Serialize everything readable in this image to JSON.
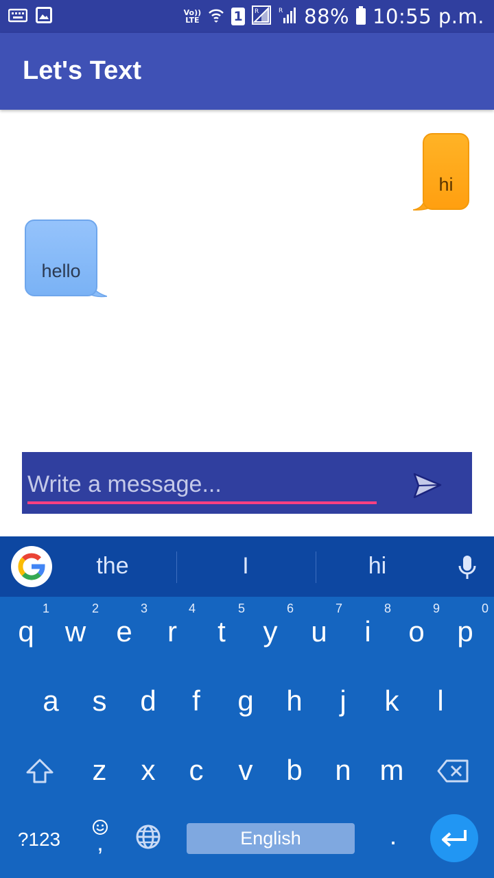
{
  "status_bar": {
    "volte_top": "Vo))",
    "volte_bottom": "LTE",
    "sim_slot": "1",
    "battery": "88%",
    "time": "10:55 p.m."
  },
  "app_bar": {
    "title": "Let's Text"
  },
  "messages": [
    {
      "text": "hi",
      "direction": "outgoing",
      "color": "#ffa51c"
    },
    {
      "text": "hello",
      "direction": "incoming",
      "color": "#8abcf8"
    }
  ],
  "compose": {
    "placeholder": "Write a message...",
    "value": "",
    "accent": "#ff4081",
    "background": "#303f9f"
  },
  "keyboard": {
    "suggestions": [
      "the",
      "I",
      "hi"
    ],
    "row1": [
      {
        "key": "q",
        "hint": "1"
      },
      {
        "key": "w",
        "hint": "2"
      },
      {
        "key": "e",
        "hint": "3"
      },
      {
        "key": "r",
        "hint": "4"
      },
      {
        "key": "t",
        "hint": "5"
      },
      {
        "key": "y",
        "hint": "6"
      },
      {
        "key": "u",
        "hint": "7"
      },
      {
        "key": "i",
        "hint": "8"
      },
      {
        "key": "o",
        "hint": "9"
      },
      {
        "key": "p",
        "hint": "0"
      }
    ],
    "row2": [
      "a",
      "s",
      "d",
      "f",
      "g",
      "h",
      "j",
      "k",
      "l"
    ],
    "row3": [
      "z",
      "x",
      "c",
      "v",
      "b",
      "n",
      "m"
    ],
    "symbols_label": "?123",
    "comma": ",",
    "period": ".",
    "space_label": "English"
  }
}
